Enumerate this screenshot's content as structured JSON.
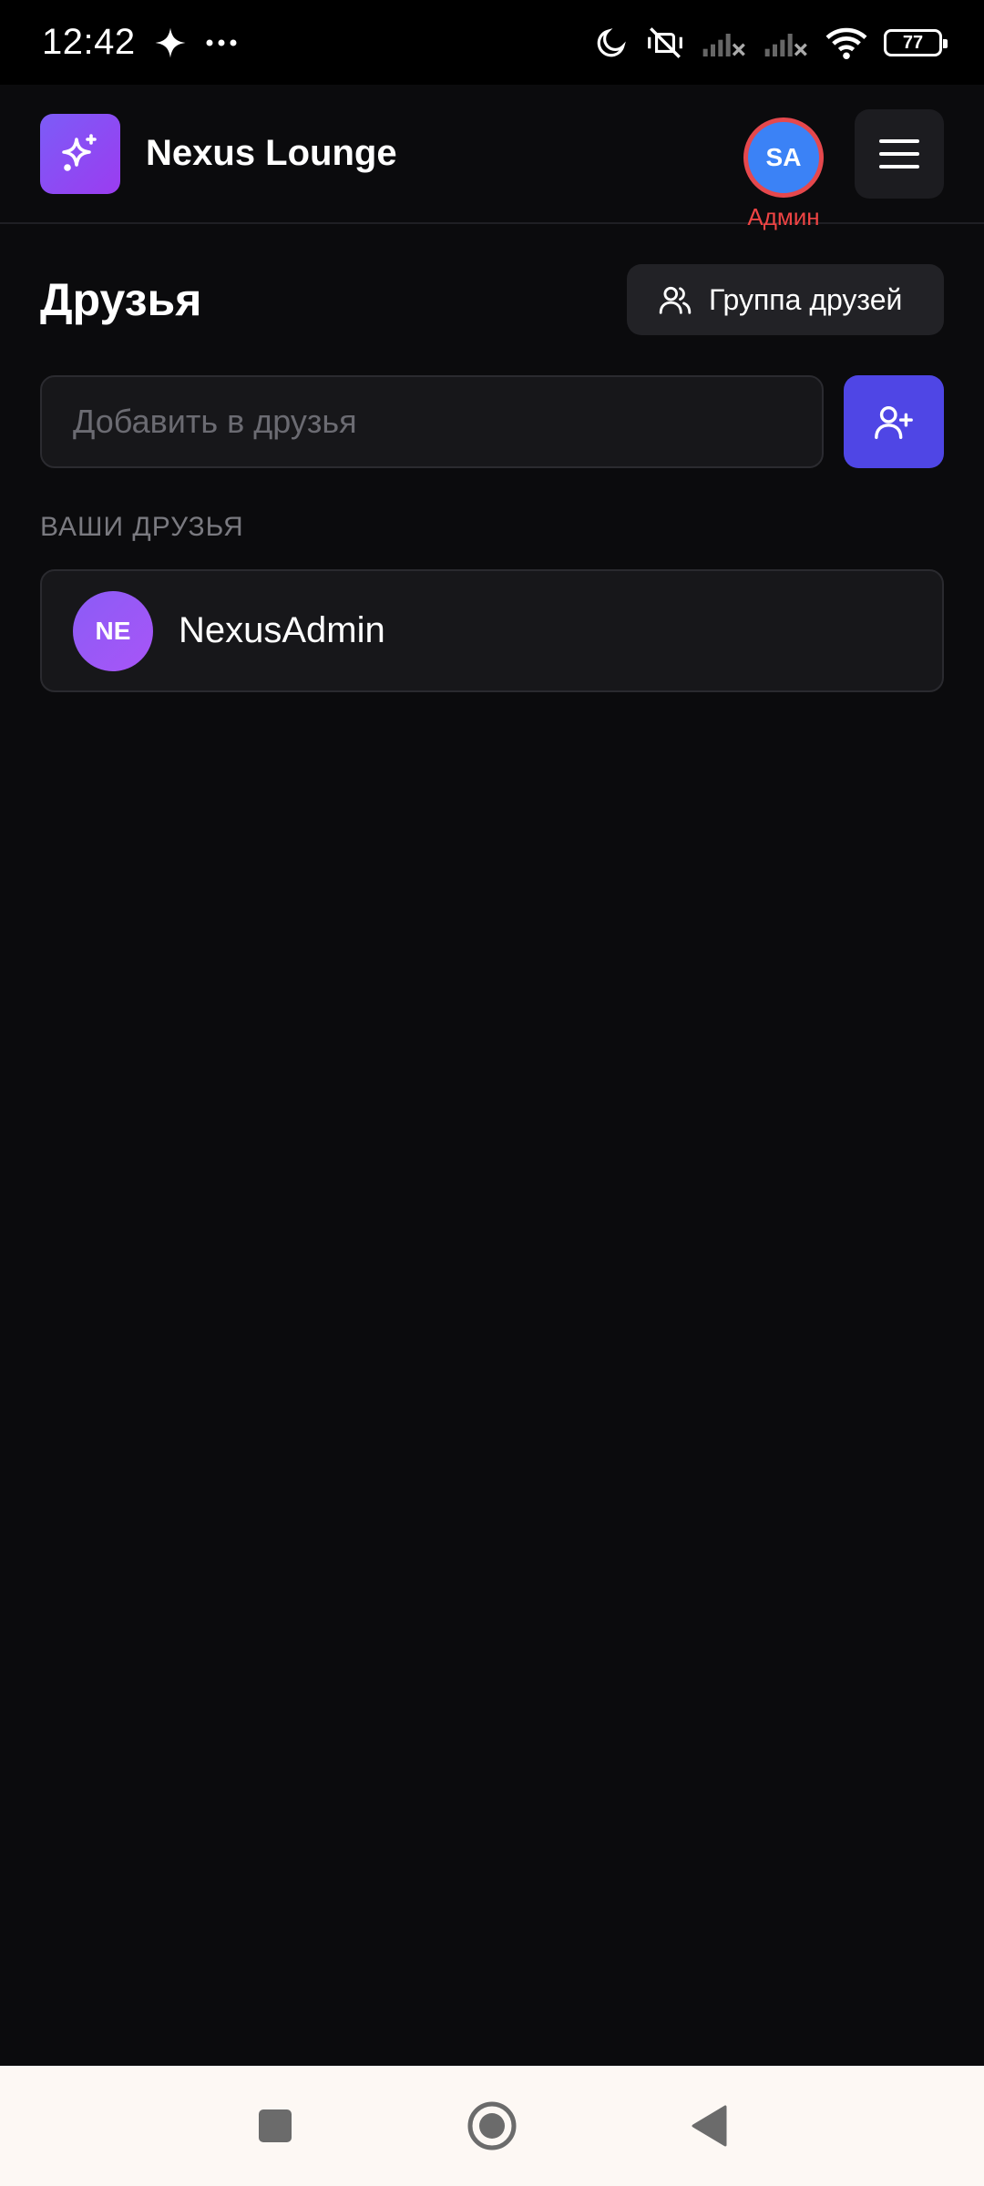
{
  "status_bar": {
    "time": "12:42",
    "battery": "77"
  },
  "header": {
    "app_title": "Nexus Lounge",
    "user_initials": "SA",
    "user_role": "Админ"
  },
  "friends_page": {
    "title": "Друзья",
    "group_button_label": "Группа друзей",
    "add_input_placeholder": "Добавить в друзья",
    "section_label": "ВАШИ ДРУЗЬЯ",
    "friends": [
      {
        "initials": "NE",
        "name": "NexusAdmin"
      }
    ]
  },
  "colors": {
    "background": "#0b0b0d",
    "accent": "#4f46e5",
    "logo_gradient": "#7c5cf7",
    "admin_red": "#ef4444",
    "user_avatar": "#3b82f6"
  },
  "icons": {
    "logo": "sparkles-icon",
    "menu": "hamburger-menu-icon",
    "group": "users-icon",
    "add_friend": "user-plus-icon",
    "nav_recents": "square-icon",
    "nav_home": "circle-icon",
    "nav_back": "triangle-back-icon"
  }
}
